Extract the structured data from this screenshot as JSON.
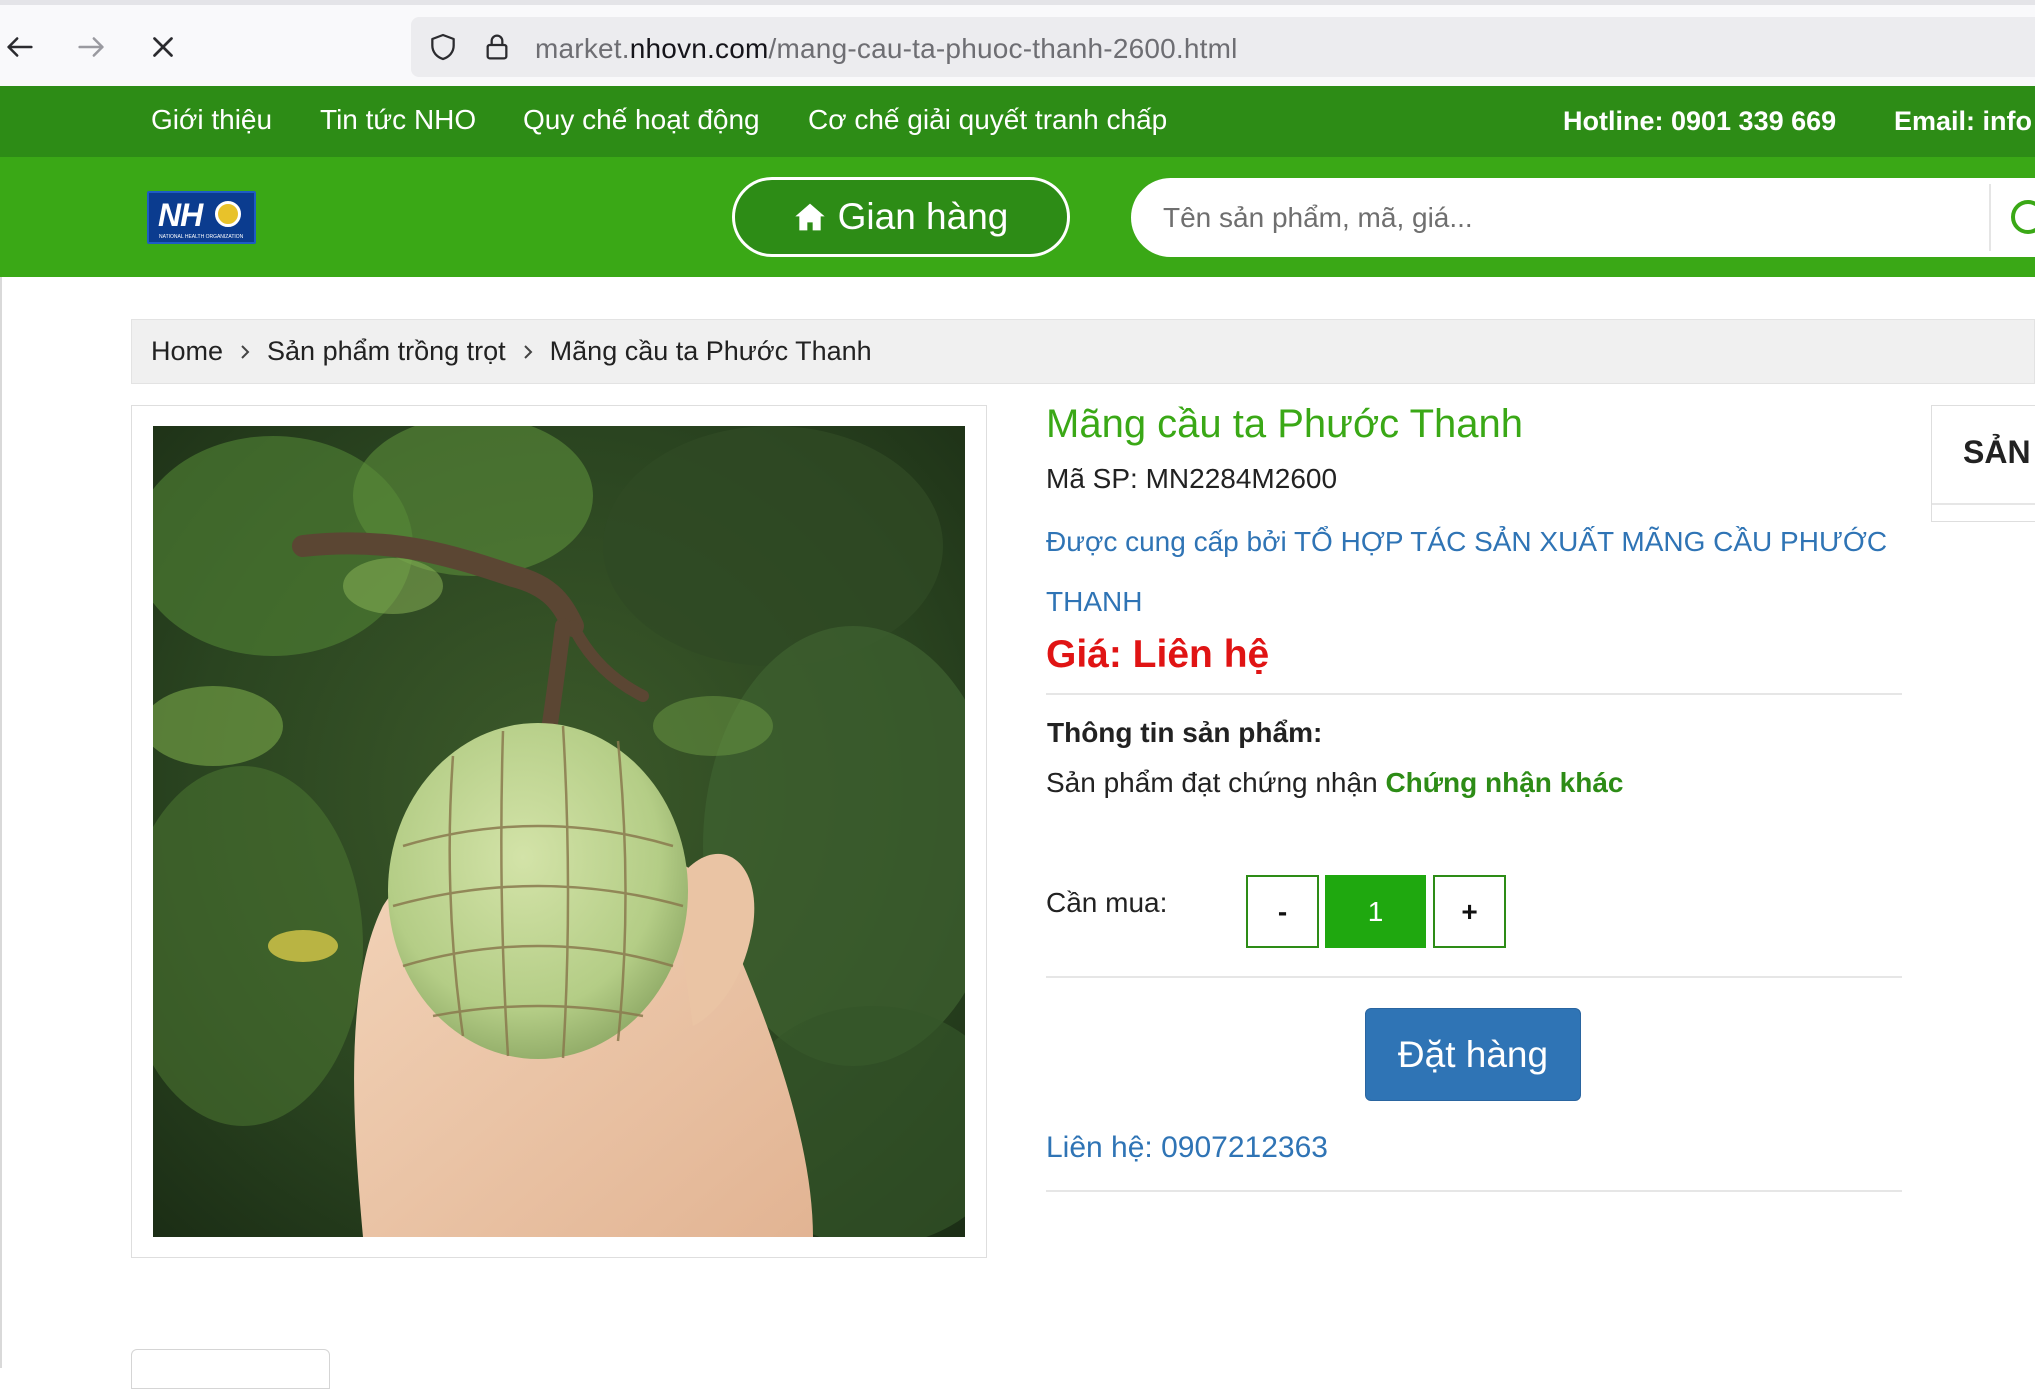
{
  "browser": {
    "url_prefix": "market.",
    "url_domain": "nhovn.com",
    "url_path": "/mang-cau-ta-phuoc-thanh-2600.html"
  },
  "topnav": {
    "links": [
      "Giới thiệu",
      "Tin tức NHO",
      "Quy chế hoạt động",
      "Cơ chế giải quyết tranh chấp"
    ],
    "hotline": "Hotline: 0901 339 669",
    "email": "Email: info"
  },
  "header": {
    "logo_text": "NH",
    "logo_tagline": "NATIONAL HEALTH ORGANIZATION",
    "shop_label": "Gian hàng",
    "search_placeholder": "Tên sản phẩm, mã, giá..."
  },
  "breadcrumb": [
    "Home",
    "Sản phẩm trồng trọt",
    "Mãng cầu ta Phước Thanh"
  ],
  "product": {
    "title": "Mãng cầu ta Phước Thanh",
    "code": "Mã SP: MN2284M2600",
    "supplier": "Được cung cấp bởi TỔ HỢP TÁC SẢN XUẤT MÃNG CẦU PHƯỚC THANH",
    "price": "Giá: Liên hệ",
    "info_heading": "Thông tin sản phẩm:",
    "cert_prefix": "Sản phẩm đạt chứng nhận",
    "cert_value": "Chứng nhận khác",
    "qty_label": "Cần mua:",
    "qty_minus": "-",
    "qty_value": "1",
    "qty_plus": "+",
    "order_label": "Đặt hàng",
    "contact": "Liên hệ: 0907212363"
  },
  "sidebar": {
    "title": "SẢN"
  },
  "colors": {
    "topnav": "#2d8c16",
    "header": "#3aa816",
    "title_green": "#3aa816",
    "price_red": "#e01414",
    "link_blue": "#2f74b5",
    "qty_green": "#1fa80f"
  },
  "icons": [
    "back-arrow-icon",
    "forward-arrow-icon",
    "close-icon",
    "shield-icon",
    "lock-icon",
    "home-icon",
    "search-icon",
    "chevron-right-icon"
  ]
}
